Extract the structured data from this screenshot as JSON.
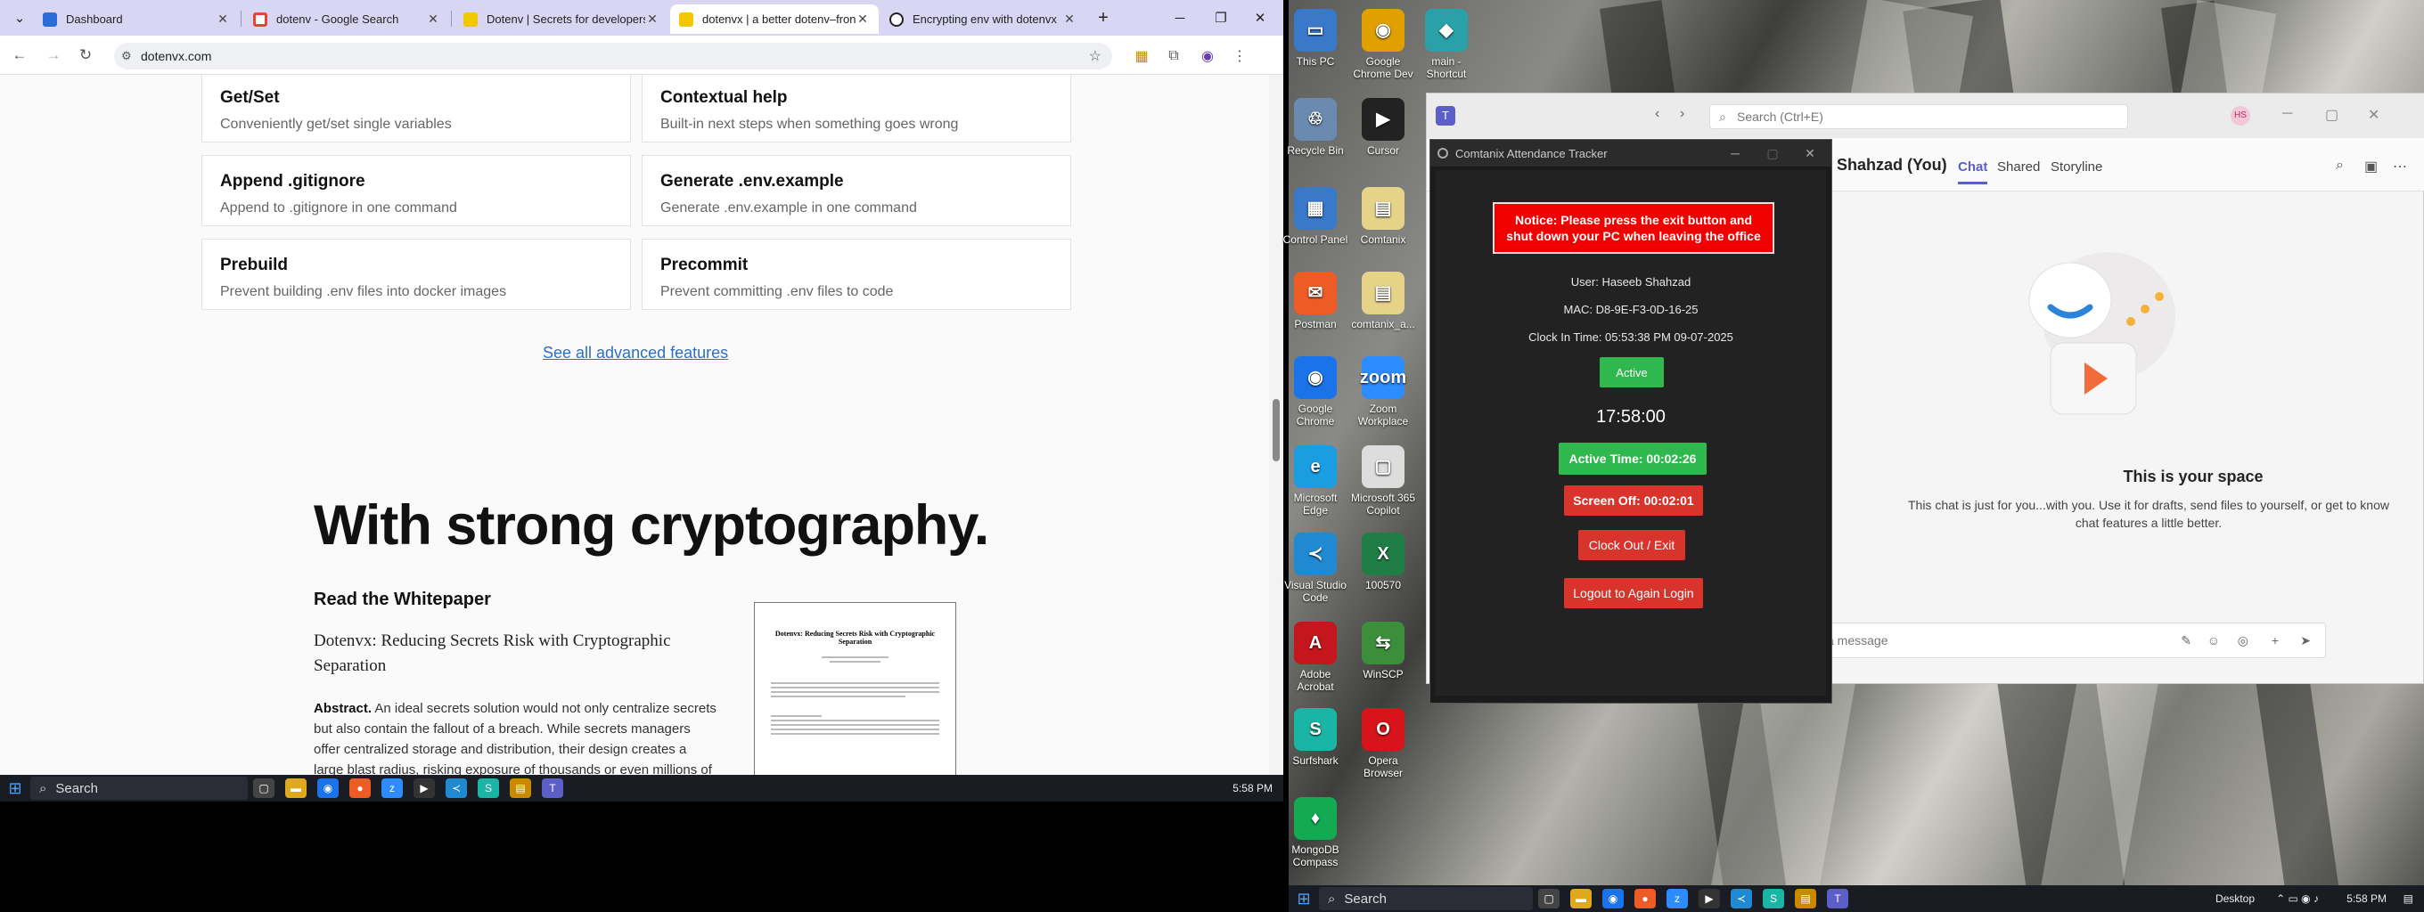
{
  "browser": {
    "tabs": [
      {
        "title": "Dashboard",
        "favicon_color": "#2d6bd8"
      },
      {
        "title": "dotenv - Google Search",
        "favicon_color": "#ea4335"
      },
      {
        "title": "Dotenv | Secrets for developers",
        "favicon_color": "#f2c700"
      },
      {
        "title": "dotenvx | a better dotenv–fron",
        "favicon_color": "#f2c700"
      },
      {
        "title": "Encrypting env with dotenvx",
        "favicon_color": "#222222"
      }
    ],
    "new_tab": "+",
    "url": "dotenvx.com"
  },
  "page": {
    "features": [
      {
        "title": "Get/Set",
        "desc": "Conveniently get/set single variables"
      },
      {
        "title": "Contextual help",
        "desc": "Built-in next steps when something goes wrong"
      },
      {
        "title": "Append .gitignore",
        "desc": "Append to .gitignore in one command"
      },
      {
        "title": "Generate .env.example",
        "desc": "Generate .env.example in one command"
      },
      {
        "title": "Prebuild",
        "desc": "Prevent building .env files into docker images"
      },
      {
        "title": "Precommit",
        "desc": "Prevent committing .env files to code"
      }
    ],
    "see_all": "See all advanced features",
    "crypto_heading": "With strong cryptography.",
    "whitepaper_heading": "Read the Whitepaper",
    "whitepaper_title": "Dotenvx: Reducing Secrets Risk with Cryptographic Separation",
    "abstract_label": "Abstract.",
    "abstract_text": "An ideal secrets solution would not only centralize secrets but also contain the fallout of a breach. While secrets managers offer centralized storage and distribution, their design creates a large blast radius, risking exposure of thousands or even millions of secrets. We",
    "paper_thumb_title": "Dotenvx: Reducing Secrets Risk with Cryptographic Separation"
  },
  "left_taskbar": {
    "search": "Search",
    "time": "5:58 PM"
  },
  "desktop_icons": [
    {
      "label": "This PC",
      "color": "#3a78c9",
      "glyph": "▭"
    },
    {
      "label": "Google Chrome Dev",
      "color": "#e0a000",
      "glyph": "◉"
    },
    {
      "label": "main - Shortcut",
      "color": "#2aa0a8",
      "glyph": "◆"
    },
    {
      "label": "Recycle Bin",
      "color": "#6a8ab0",
      "glyph": "♲"
    },
    {
      "label": "Cursor",
      "color": "#222222",
      "glyph": "▶"
    },
    {
      "label": "Control Panel",
      "color": "#3a78c9",
      "glyph": "▦"
    },
    {
      "label": "Comtanix",
      "color": "#e6d38a",
      "glyph": "▤"
    },
    {
      "label": "Postman",
      "color": "#ef5b25",
      "glyph": "✉"
    },
    {
      "label": "comtanix_a...",
      "color": "#e6d38a",
      "glyph": "▤"
    },
    {
      "label": "Google Chrome",
      "color": "#1a73e8",
      "glyph": "◉"
    },
    {
      "label": "Zoom Workplace",
      "color": "#2d8cff",
      "glyph": "zoom"
    },
    {
      "label": "Microsoft Edge",
      "color": "#1b9de2",
      "glyph": "e"
    },
    {
      "label": "Microsoft 365 Copilot",
      "color": "#dddddd",
      "glyph": "▢"
    },
    {
      "label": "Visual Studio Code",
      "color": "#1f8ad2",
      "glyph": "≺"
    },
    {
      "label": "100570",
      "color": "#1e7e45",
      "glyph": "X"
    },
    {
      "label": "Adobe Acrobat",
      "color": "#c4161c",
      "glyph": "A"
    },
    {
      "label": "WinSCP",
      "color": "#3c8d3c",
      "glyph": "⇆"
    },
    {
      "label": "Surfshark",
      "color": "#1bb5a5",
      "glyph": "S"
    },
    {
      "label": "Opera Browser",
      "color": "#d7141a",
      "glyph": "O"
    },
    {
      "label": "MongoDB Compass",
      "color": "#13aa52",
      "glyph": "♦"
    }
  ],
  "teams": {
    "search": "Search (Ctrl+E)",
    "user_title": "Shahzad (You)",
    "tabs": [
      "Chat",
      "Shared",
      "Storyline"
    ],
    "space_title": "This is your space",
    "space_desc": "This chat is just for you...with you. Use it for drafts, send files to yourself, or get to know chat features a little better.",
    "compose_placeholder": "a message",
    "avatar_initials": "HS"
  },
  "tracker": {
    "title": "Comtanix Attendance Tracker",
    "notice": "Notice: Please press the exit button and shut down your PC when leaving the office",
    "user": "User: Haseeb Shahzad",
    "mac": "MAC: D8-9E-F3-0D-16-25",
    "clock_in": "Clock In Time: 05:53:38 PM 09-07-2025",
    "status": "Active",
    "clock": "17:58:00",
    "active_time": "Active Time: 00:02:26",
    "screen_off": "Screen Off: 00:02:01",
    "clock_out": "Clock Out / Exit",
    "logout": "Logout to Again Login"
  },
  "right_taskbar": {
    "search": "Search",
    "desktop": "Desktop",
    "time": "5:58 PM"
  }
}
